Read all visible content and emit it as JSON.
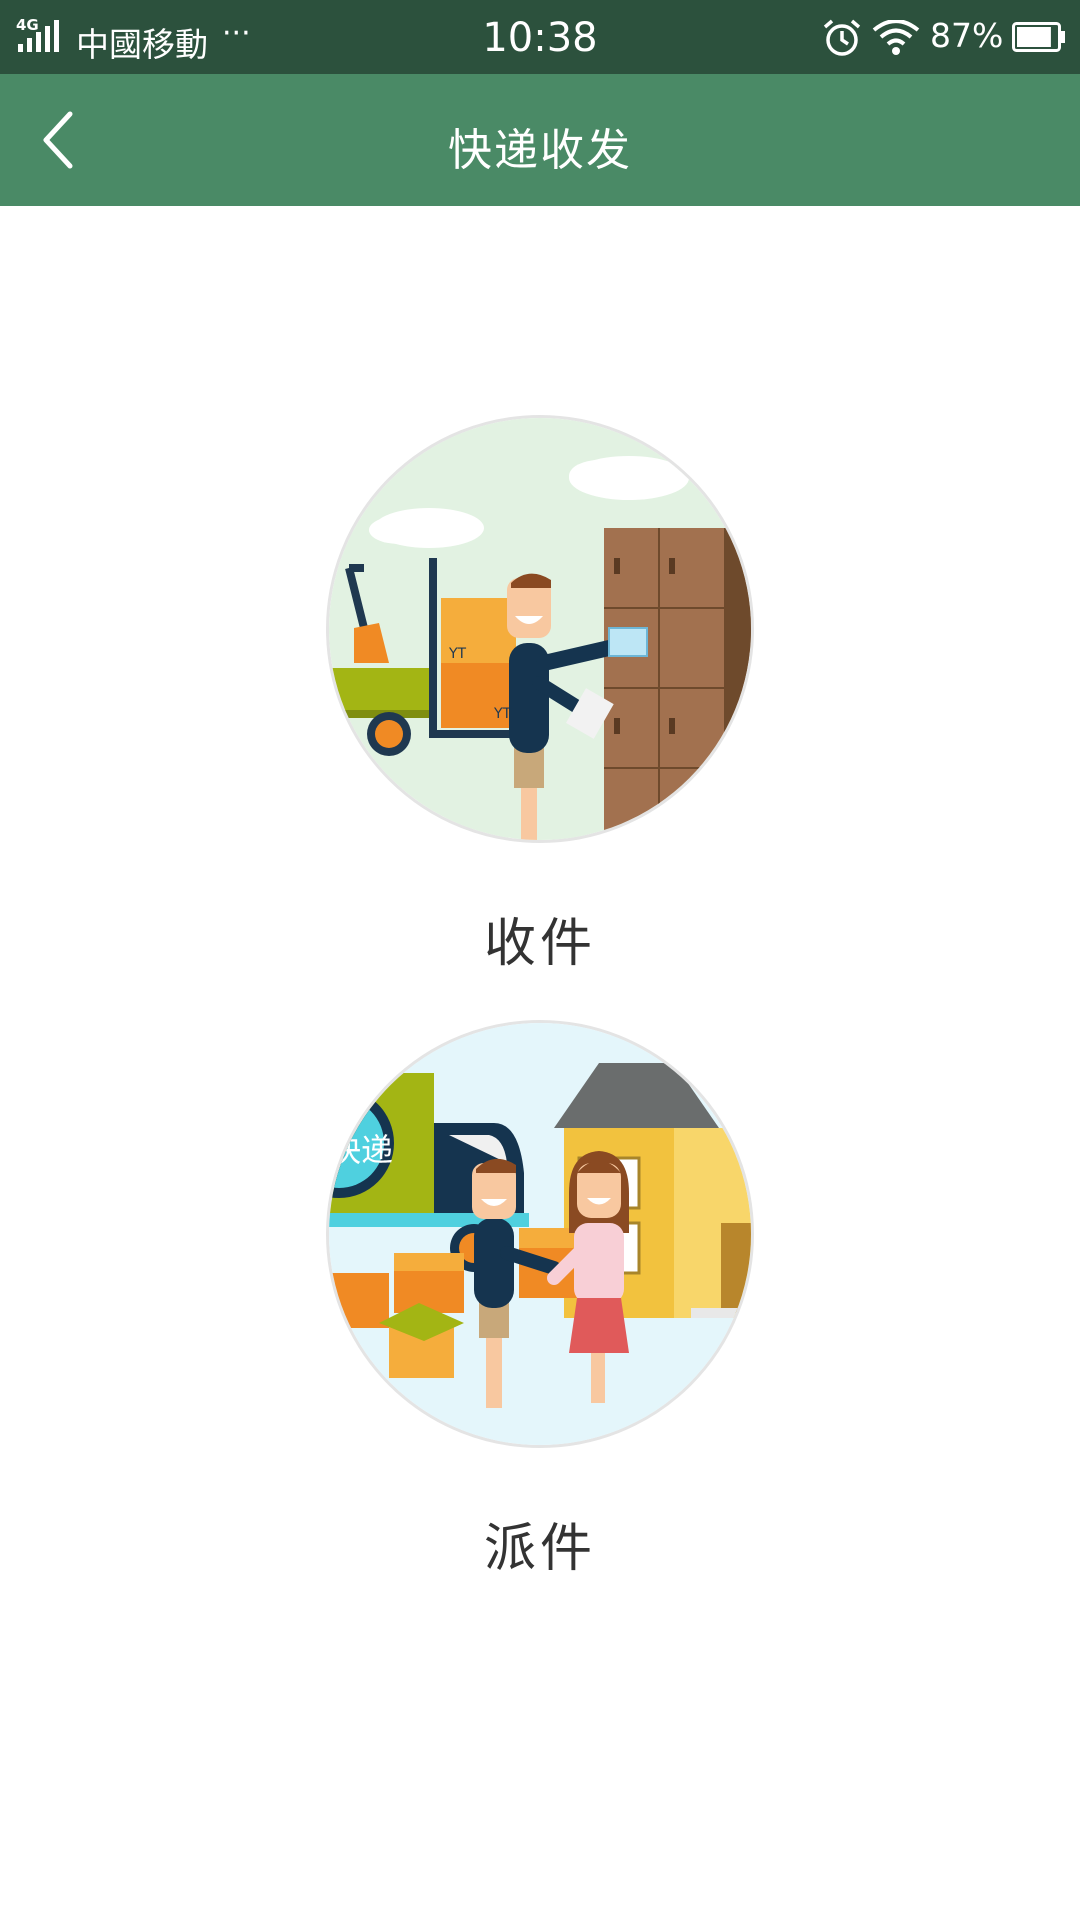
{
  "status_bar": {
    "network": "4G",
    "carrier": "中國移動",
    "more": "···",
    "time": "10:38",
    "battery_percent": "87%",
    "battery_level": 0.87,
    "icons": [
      "signal-icon",
      "alarm-icon",
      "wifi-icon",
      "battery-icon"
    ]
  },
  "app_bar": {
    "title": "快递收发",
    "back_icon": "chevron-left-icon"
  },
  "options": [
    {
      "label": "收件",
      "illustration_text": ""
    },
    {
      "label": "派件",
      "illustration_text": "快递"
    }
  ],
  "colors": {
    "status_bar": "#2c513d",
    "app_bar": "#4a8a66",
    "label_text": "#333333"
  }
}
